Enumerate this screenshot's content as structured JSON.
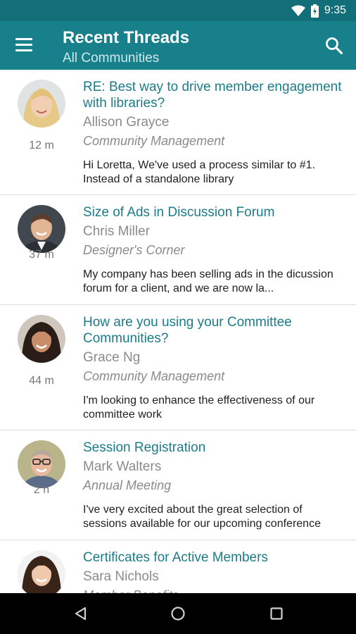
{
  "status_bar": {
    "time": "9:35",
    "icons": [
      "wifi-icon",
      "battery-charging-icon"
    ]
  },
  "app_bar": {
    "title": "Recent Threads",
    "subtitle": "All Communities",
    "left_icon": "menu-icon",
    "right_icon": "search-icon"
  },
  "colors": {
    "status_bar": "#126f7a",
    "app_bar": "#17808b",
    "link": "#1b7c88",
    "meta": "#8a8a8a"
  },
  "threads": [
    {
      "subject": "RE: Best way to drive member engagement with libraries?",
      "author": "Allison Grayce",
      "community": "Community Management",
      "time": "12 m",
      "preview": "Hi Loretta, We've used a process similar to #1. Instead of a standalone library"
    },
    {
      "subject": "Size of Ads in Discussion Forum",
      "author": "Chris Miller",
      "community": "Designer's Corner",
      "time": "37 m",
      "preview": "My company has been selling ads in the dicussion forum for a client, and we are now la..."
    },
    {
      "subject": "How are you using your Committee Communities?",
      "author": "Grace Ng",
      "community": "Community Management",
      "time": "44 m",
      "preview": "I'm looking to enhance the effectiveness of our committee work"
    },
    {
      "subject": "Session Registration",
      "author": "Mark Walters",
      "community": "Annual Meeting",
      "time": "2 h",
      "preview": "I've very excited about the great selection of sessions available for our upcoming conference"
    },
    {
      "subject": "Certificates for Active Members",
      "author": "Sara Nichols",
      "community": "Member Benefits",
      "time": "",
      "preview": ""
    }
  ],
  "nav_bar": {
    "icons": [
      "back-icon",
      "home-icon",
      "recents-icon"
    ]
  }
}
